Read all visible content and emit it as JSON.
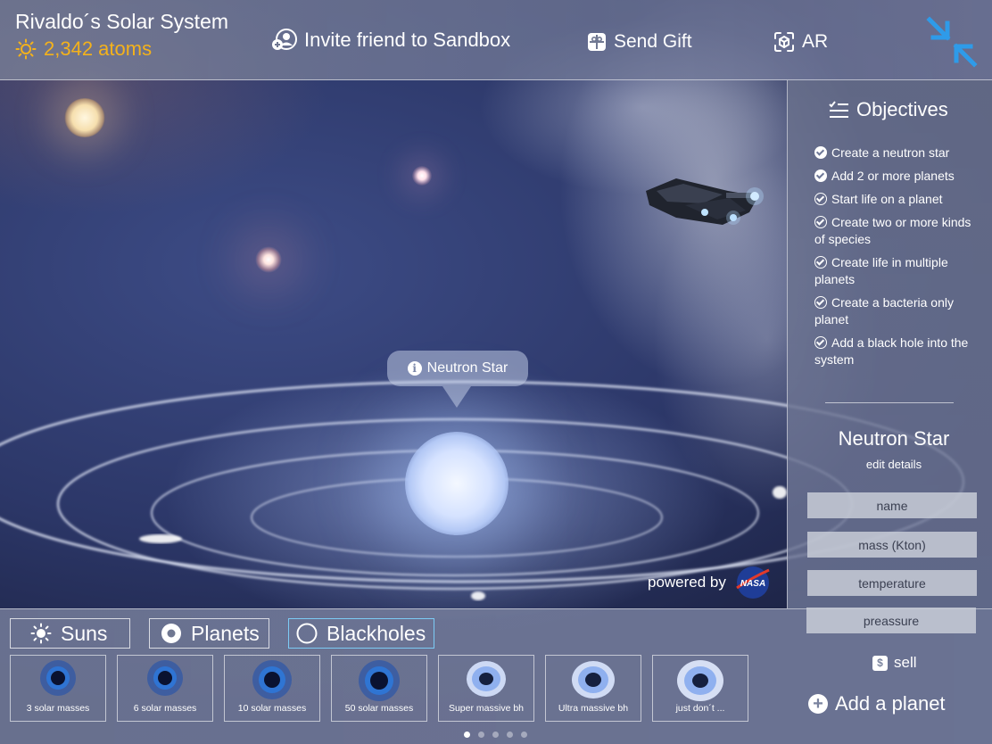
{
  "header": {
    "title": "Rivaldo´s Solar System",
    "atoms": "2,342 atoms",
    "invite_label": "Invite friend to Sandbox",
    "gift_label": "Send Gift",
    "ar_label": "AR"
  },
  "scene": {
    "tooltip_label": "Neutron Star",
    "powered_by": "powered by",
    "nasa_logo_text": "NASA"
  },
  "objectives": {
    "title": "Objectives",
    "items": [
      {
        "label": "Create a neutron star",
        "done": true
      },
      {
        "label": "Add 2 or more planets",
        "done": true
      },
      {
        "label": "Start life on a planet",
        "done": false
      },
      {
        "label": "Create two or more kinds of species",
        "done": false
      },
      {
        "label": "Create life in multiple planets",
        "done": false
      },
      {
        "label": "Create a bacteria only planet",
        "done": false
      },
      {
        "label": "Add a black hole into the system",
        "done": false
      }
    ]
  },
  "details": {
    "title": "Neutron Star",
    "subtitle": "edit details",
    "fields": [
      "name",
      "mass (Kton)",
      "temperature",
      "preassure"
    ]
  },
  "categories": {
    "suns": "Suns",
    "planets": "Planets",
    "blackholes": "Blackholes"
  },
  "items": [
    "3 solar masses",
    "6 solar masses",
    "10 solar masses",
    "50 solar masses",
    "Super massive bh",
    "Ultra massive bh",
    "just don´t ..."
  ],
  "actions": {
    "sell": "sell",
    "add_planet": "Add a planet"
  },
  "colors": {
    "atoms": "#f4b21b",
    "accent_blue": "#2e9be9"
  }
}
